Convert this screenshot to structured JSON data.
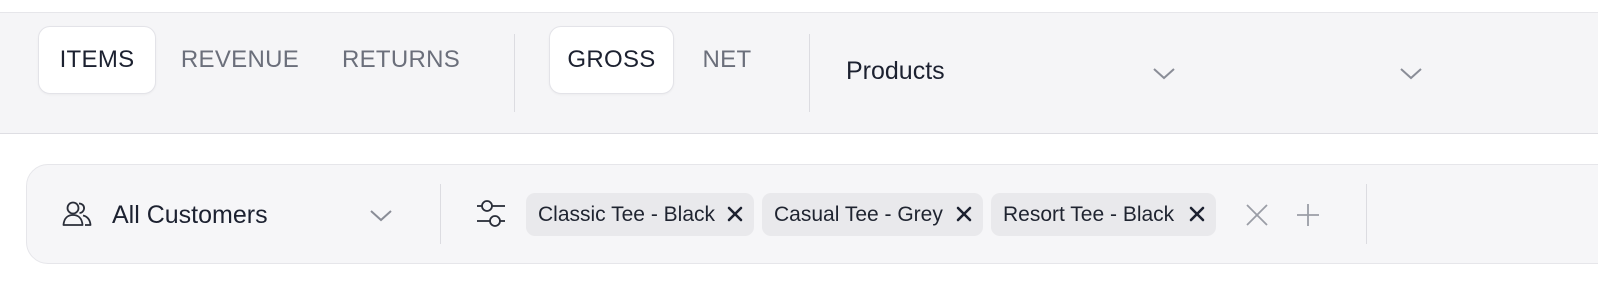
{
  "metric_tabs": [
    {
      "label": "ITEMS",
      "active": true
    },
    {
      "label": "REVENUE",
      "active": false
    },
    {
      "label": "RETURNS",
      "active": false
    }
  ],
  "value_tabs": [
    {
      "label": "GROSS",
      "active": true
    },
    {
      "label": "NET",
      "active": false
    }
  ],
  "group_by_select": {
    "value": "Products"
  },
  "second_select": {
    "value": ""
  },
  "customer_select": {
    "value": "All Customers",
    "icon": "users-icon"
  },
  "filter_icon": "sliders-icon",
  "chips": [
    {
      "label": "Classic Tee - Black"
    },
    {
      "label": "Casual Tee - Grey"
    },
    {
      "label": "Resort Tee - Black"
    }
  ],
  "colors": {
    "toolbar_bg": "#f5f5f7",
    "active_bg": "#ffffff",
    "chip_bg": "#e9e9ec",
    "text_dark": "#1c2130",
    "text_muted": "#6b6f7b"
  }
}
